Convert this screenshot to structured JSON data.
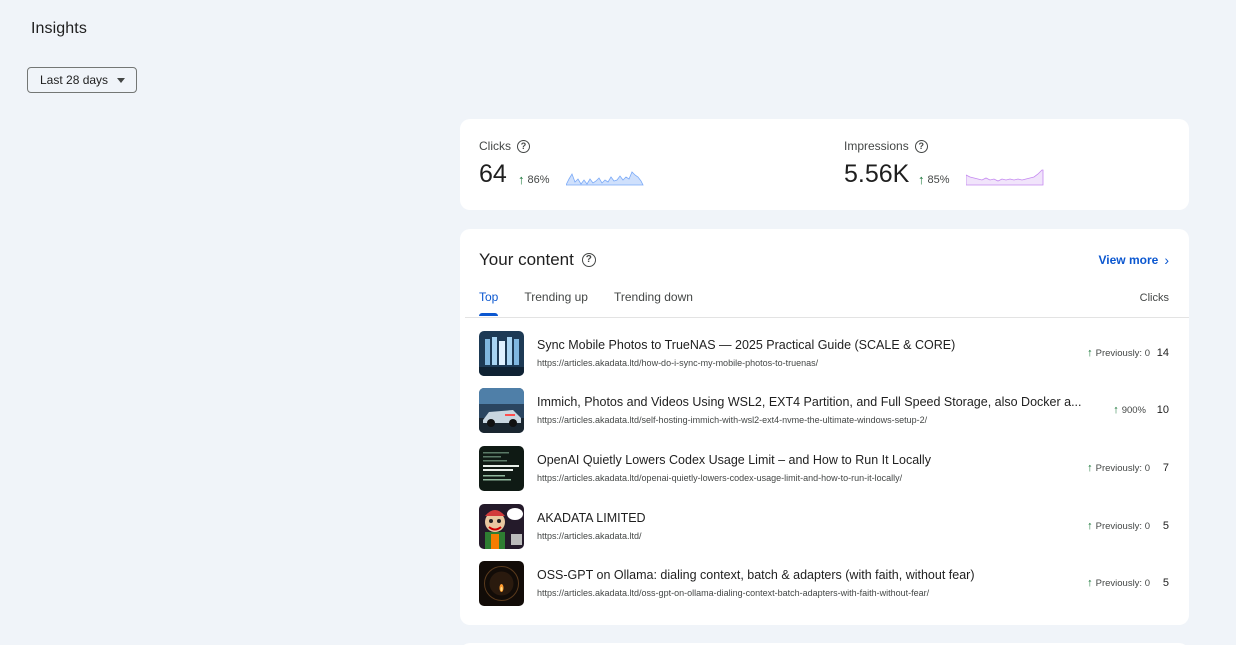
{
  "page": {
    "title": "Insights"
  },
  "date_range": {
    "label": "Last 28 days"
  },
  "stats": {
    "clicks": {
      "label": "Clicks",
      "value": "64",
      "change": "86%"
    },
    "impressions": {
      "label": "Impressions",
      "value": "5.56K",
      "change": "85%"
    }
  },
  "content": {
    "title": "Your content",
    "view_more": "View more",
    "tabs": [
      "Top",
      "Trending up",
      "Trending down"
    ],
    "column_header": "Clicks",
    "rows": [
      {
        "title": "Sync Mobile Photos to TrueNAS — 2025 Practical Guide (SCALE & CORE)",
        "url": "https://articles.akadata.ltd/how-do-i-sync-my-mobile-photos-to-truenas/",
        "change": "Previously: 0",
        "clicks": "14"
      },
      {
        "title": "Immich, Photos and Videos Using WSL2, EXT4 Partition, and Full Speed Storage, also Docker a...",
        "url": "https://articles.akadata.ltd/self-hosting-immich-with-wsl2-ext4-nvme-the-ultimate-windows-setup-2/",
        "change": "900%",
        "clicks": "10"
      },
      {
        "title": "OpenAI Quietly Lowers Codex Usage Limit – and How to Run It Locally",
        "url": "https://articles.akadata.ltd/openai-quietly-lowers-codex-usage-limit-and-how-to-run-it-locally/",
        "change": "Previously: 0",
        "clicks": "7"
      },
      {
        "title": "AKADATA LIMITED",
        "url": "https://articles.akadata.ltd/",
        "change": "Previously: 0",
        "clicks": "5"
      },
      {
        "title": "OSS-GPT on Ollama: dialing context, batch & adapters (with faith, without fear)",
        "url": "https://articles.akadata.ltd/oss-gpt-on-ollama-dialing-context-batch-adapters-with-faith-without-fear/",
        "change": "Previously: 0",
        "clicks": "5"
      }
    ]
  },
  "colors": {
    "accent": "#0b57d0",
    "positive": "#137333",
    "background": "#f0f4f9"
  }
}
